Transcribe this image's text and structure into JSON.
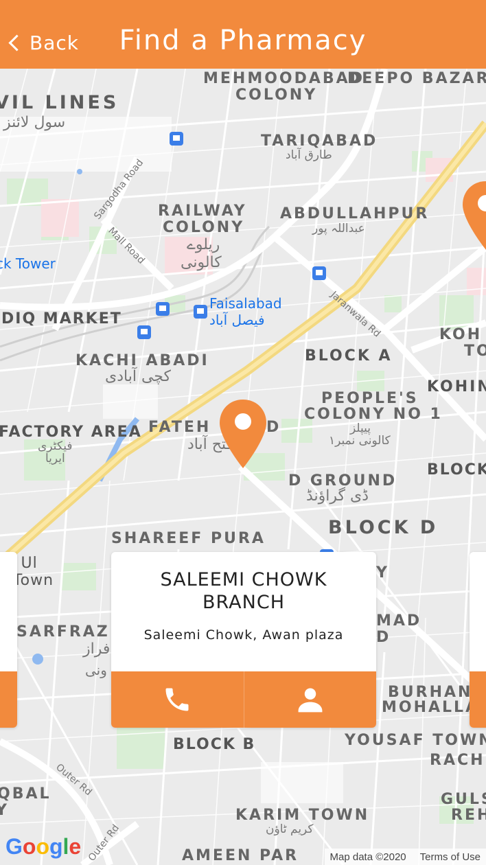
{
  "header": {
    "back_label": "Back",
    "title": "Find a Pharmacy",
    "color": "#f28a3d"
  },
  "map": {
    "labels": [
      {
        "text": "MEHMOODABAD",
        "cls": ""
      },
      {
        "text": "DEEPO BAZAR",
        "cls": ""
      },
      {
        "text": "COLONY",
        "cls": ""
      },
      {
        "text": "VIL LINES",
        "cls": "big"
      },
      {
        "text": "TARIQABAD",
        "cls": ""
      },
      {
        "text": "RAILWAY",
        "cls": ""
      },
      {
        "text": "COLONY",
        "cls": ""
      },
      {
        "text": "ABDULLAHPUR",
        "cls": ""
      },
      {
        "text": "DIQ MARKET",
        "cls": "dark"
      },
      {
        "text": "KACHI ABADI",
        "cls": ""
      },
      {
        "text": "BLOCK A",
        "cls": "dark"
      },
      {
        "text": "KOH",
        "cls": ""
      },
      {
        "text": "TO",
        "cls": ""
      },
      {
        "text": "KOHINC",
        "cls": "dark"
      },
      {
        "text": "PEOPLE'S",
        "cls": ""
      },
      {
        "text": "COLONY NO 1",
        "cls": ""
      },
      {
        "text": "FACTORY AREA",
        "cls": "dark"
      },
      {
        "text": "FATEH",
        "cls": ""
      },
      {
        "text": "B",
        "cls": ""
      },
      {
        "text": "D",
        "cls": ""
      },
      {
        "text": "BLOCK",
        "cls": "dark"
      },
      {
        "text": "D GROUND",
        "cls": ""
      },
      {
        "text": "BLOCK D",
        "cls": "big"
      },
      {
        "text": "SHAREEF PURA",
        "cls": ""
      },
      {
        "text": "ar Ul",
        "cls": ""
      },
      {
        "text": "n Town",
        "cls": ""
      },
      {
        "text": "SARFRAZ",
        "cls": ""
      },
      {
        "text": "Y",
        "cls": ""
      },
      {
        "text": "MAD",
        "cls": ""
      },
      {
        "text": "D",
        "cls": ""
      },
      {
        "text": "BURHAN",
        "cls": ""
      },
      {
        "text": "MOHALLA",
        "cls": ""
      },
      {
        "text": "BLOCK B",
        "cls": "dark"
      },
      {
        "text": "YOUSAF TOWN",
        "cls": ""
      },
      {
        "text": "RACHN",
        "cls": ""
      },
      {
        "text": "QBAL",
        "cls": ""
      },
      {
        "text": "Y",
        "cls": ""
      },
      {
        "text": "GULSI",
        "cls": ""
      },
      {
        "text": "REH",
        "cls": ""
      },
      {
        "text": "KARIM TOWN",
        "cls": ""
      },
      {
        "text": "AMEEN PAR",
        "cls": ""
      }
    ],
    "urdu": [
      "سول لائنز",
      "طارق آباد",
      "ریلوے",
      "کالونی",
      "عبداللہ پور",
      "کچی آبادی",
      "پیپلز",
      "کالونی نمبر١",
      "فیکٹری",
      "ایریا",
      "فتح آباد",
      "ڈی گراؤنڈ",
      "فراز",
      "ونی",
      "کریم ٹاؤن"
    ],
    "poi": {
      "name": "Faisalabad",
      "urdu": "فیصل آباد",
      "clock_tower": "ck Tower"
    },
    "roads": [
      "Sargodha Road",
      "Mall Road",
      "Jaranwala Rd",
      "Outer Rd",
      "Outer Rd"
    ],
    "google": {
      "letters": [
        "G",
        "o",
        "o",
        "g",
        "l",
        "e"
      ],
      "colors": [
        "#4285f4",
        "#ea4335",
        "#fbbc05",
        "#4285f4",
        "#34a853",
        "#ea4335"
      ]
    },
    "attribution": {
      "map_data": "Map data ©2020",
      "terms": "Terms of Use"
    }
  },
  "pharmacy": {
    "name": "SALEEMI CHOWK BRANCH",
    "address": "Saleemi Chowk,  Awan  plaza",
    "call_icon": "phone-icon",
    "profile_icon": "person-icon",
    "accent": "#f28a3d"
  }
}
